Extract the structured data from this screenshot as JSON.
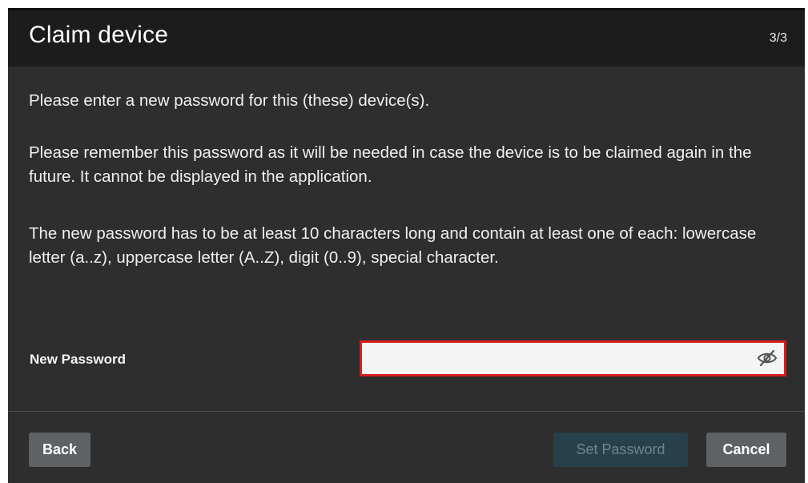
{
  "dialog": {
    "title": "Claim device",
    "step": "3/3"
  },
  "body": {
    "paragraph1": "Please enter a new password for this (these) device(s).",
    "paragraph2": "Please remember this password as it will be needed in case the device is to be claimed again in the future. It cannot be displayed in the application.",
    "paragraph3": "The new password has to be at least 10 characters long and contain at least one of each: lowercase letter (a..z), uppercase letter (A..Z), digit (0..9), special character."
  },
  "password": {
    "label": "New Password",
    "value": "",
    "placeholder": "",
    "visibility_icon": "eye-slash-icon",
    "error_border_color": "#d81e1e"
  },
  "footer": {
    "back_label": "Back",
    "set_password_label": "Set Password",
    "set_password_state": "disabled",
    "cancel_label": "Cancel"
  },
  "colors": {
    "dialog_background": "#2e2e2e",
    "header_background": "#1c1c1c",
    "button_background": "#5f6264",
    "disabled_primary_background": "#27404c"
  }
}
